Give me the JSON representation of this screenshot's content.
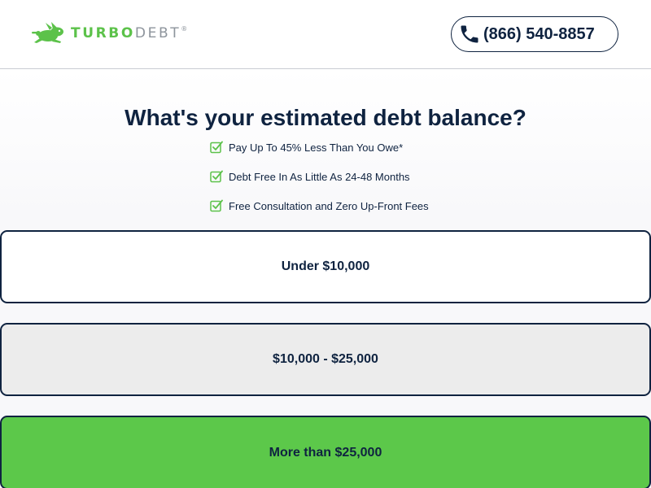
{
  "header": {
    "logo": {
      "icon": "rabbit-icon",
      "turbo_text": "TURBO",
      "debt_text": "DEBT",
      "registered_mark": "®"
    },
    "phone": {
      "icon": "phone-icon",
      "number": "(866) 540-8857"
    }
  },
  "main": {
    "headline": "What's your estimated debt balance?",
    "benefits": [
      {
        "icon": "checkbox-check-icon",
        "text": "Pay Up To 45% Less Than You Owe*"
      },
      {
        "icon": "checkbox-check-icon",
        "text": "Debt Free In As Little As 24-48 Months"
      },
      {
        "icon": "checkbox-check-icon",
        "text": "Free Consultation and Zero Up-Front Fees"
      }
    ],
    "options": [
      {
        "label": "Under $10,000"
      },
      {
        "label": "$10,000 - $25,000"
      },
      {
        "label": "More than $25,000"
      }
    ]
  },
  "colors": {
    "brand_green": "#5cc24a",
    "navy": "#0f2340",
    "logo_gray": "#8d949c",
    "option_highlight": "#5cc84a",
    "option_hover": "#ececec"
  }
}
